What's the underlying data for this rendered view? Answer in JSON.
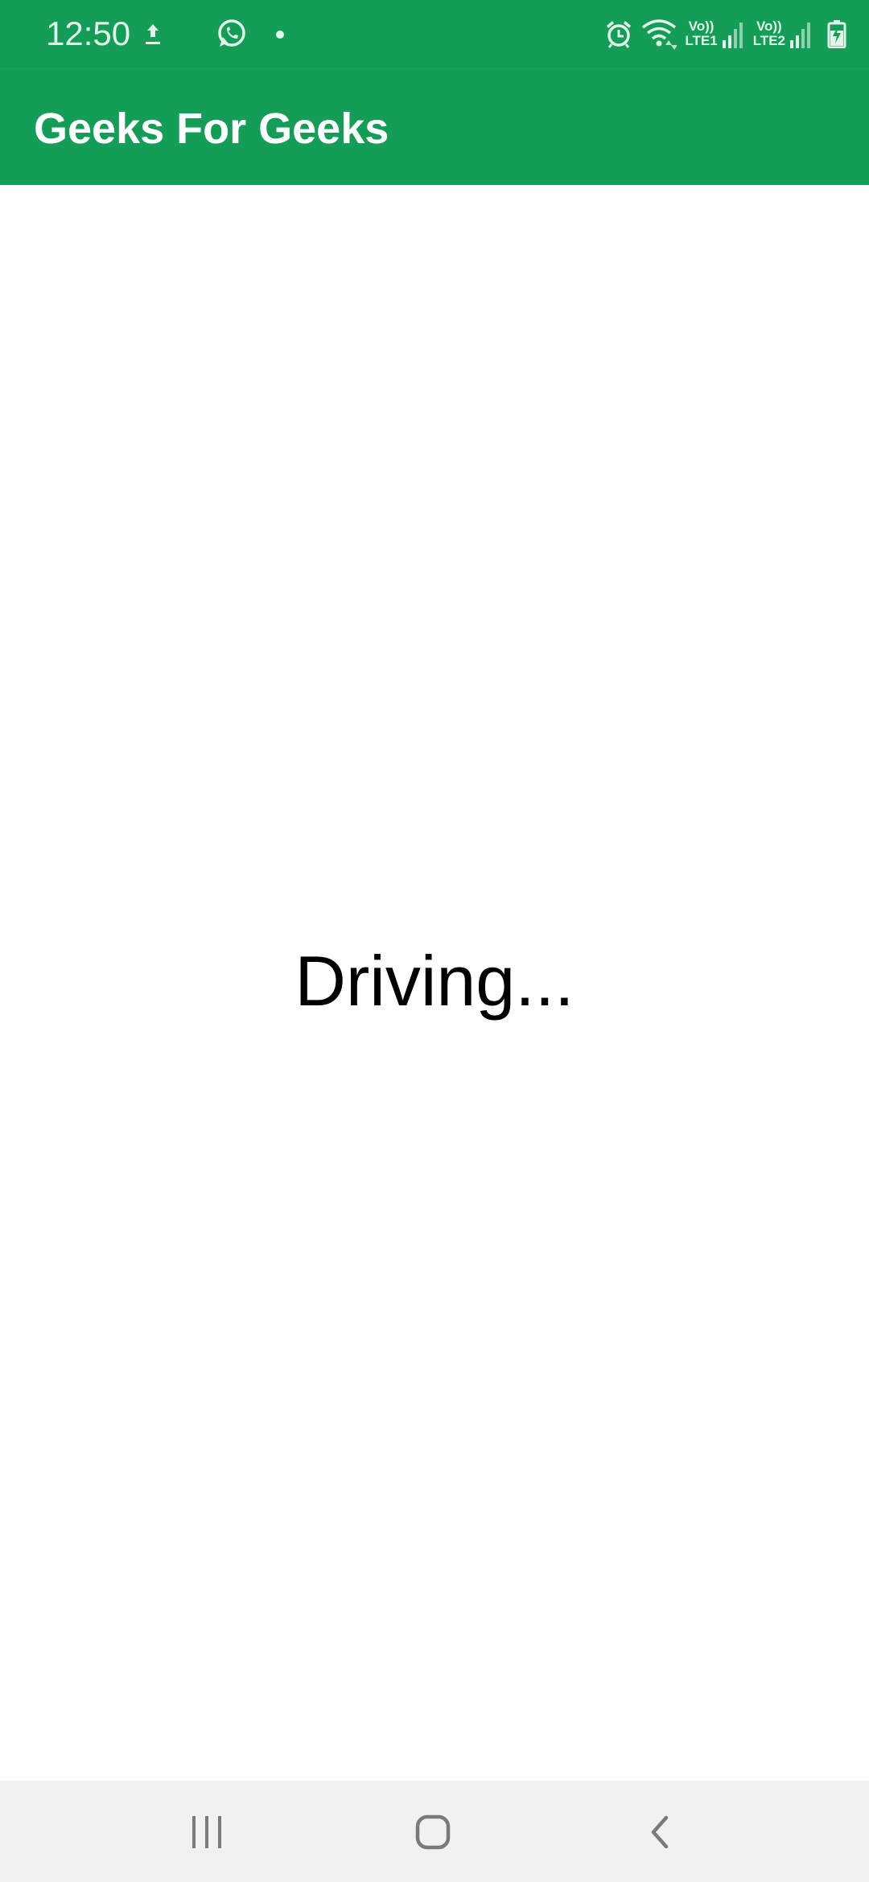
{
  "status_bar": {
    "time": "12:50",
    "left_icons": [
      "upload-icon",
      "whatsapp-icon",
      "notification-dot-icon"
    ],
    "right_icons": [
      "alarm-icon",
      "wifi-icon",
      "signal-icon",
      "signal-icon",
      "battery-charging-icon"
    ],
    "sim1_label_top": "Vo))",
    "sim1_label_bottom": "LTE1",
    "sim2_label_top": "Vo))",
    "sim2_label_bottom": "LTE2",
    "background_color": "#139d57"
  },
  "app_bar": {
    "title": "Geeks For Geeks",
    "background_color": "#139d57"
  },
  "main": {
    "status_text": "Driving..."
  },
  "nav_bar": {
    "buttons": [
      "recent-apps-icon",
      "home-icon",
      "back-icon"
    ]
  }
}
